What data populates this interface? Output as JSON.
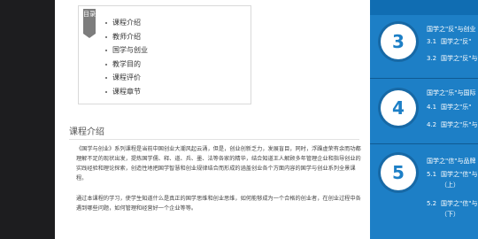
{
  "toc": {
    "badge": "目录",
    "items": [
      "课程介绍",
      "教师介绍",
      "国学与创业",
      "教学目的",
      "课程评价",
      "课程章节"
    ]
  },
  "section": {
    "title": "课程介绍",
    "p1": "《国学与创业》系列课程是当前中国创业大潮风起云涌，但是，创业创新乏力，发展盲目，同时，浮躁虚荣有余而功都理解不足的现状出发，提炼国学儒、释、道、兵、墨、法等各家的精华，结合知道王人解顾多年管理企业和指导创业的实践经验和理论探索，创造性地把国学智慧和创业规律结合而形成的涵盖创业各个方面内容的国学与创业系列全景课程。",
    "p2": "通过本课程的学习，使学生知道什么是真正的国学思维和创业思维，如何能够成为一个合格的创业者，在创业过程中各遇到哪些问题，如何管理和经营好一个企业等等。"
  },
  "chapters": [
    {
      "num": "3",
      "title": "国学之\"反\"与创业",
      "subs": [
        {
          "n": "3.1",
          "t": "国学之\"反\""
        },
        {
          "n": "3.2",
          "t": "国学之\"反\"与创"
        }
      ]
    },
    {
      "num": "4",
      "title": "国学之\"乐\"与国际",
      "subs": [
        {
          "n": "4.1",
          "t": "国学之\"乐\""
        },
        {
          "n": "4.2",
          "t": "国学之\"乐\"与"
        }
      ]
    },
    {
      "num": "5",
      "title": "国学之\"信\"与品牌",
      "subs": [
        {
          "n": "5.1",
          "t": "国学之\"信\"与"
        },
        {
          "n": "",
          "t": "（上）"
        },
        {
          "n": "5.2",
          "t": "国学之\"信\"与"
        },
        {
          "n": "",
          "t": "（下）"
        }
      ]
    }
  ]
}
